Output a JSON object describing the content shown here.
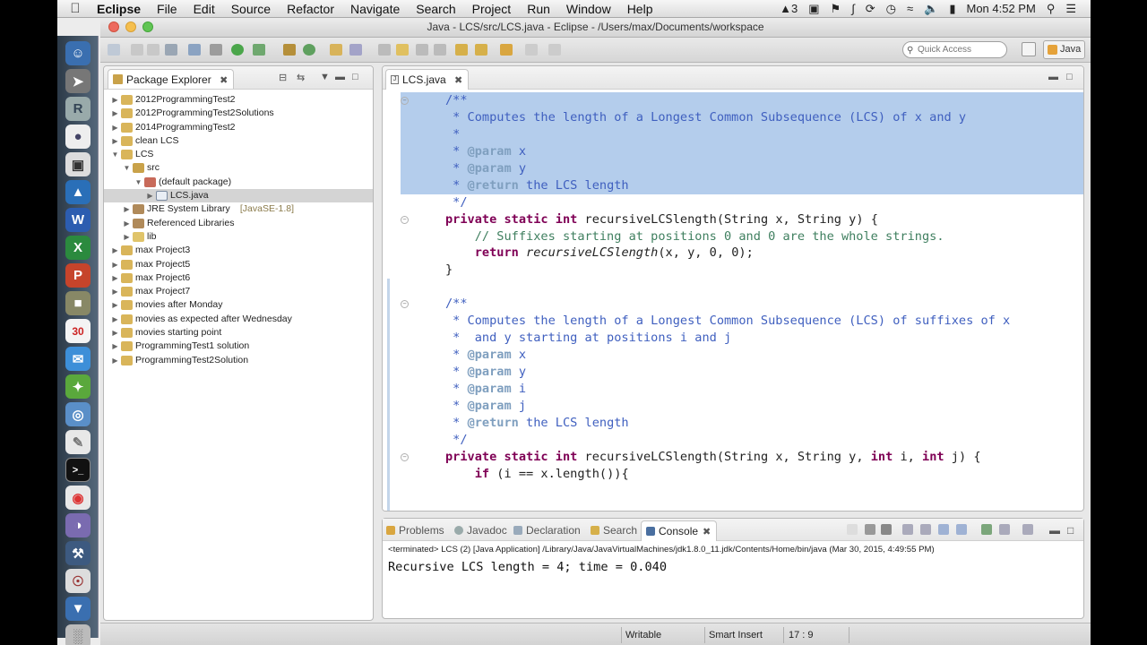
{
  "menubar": {
    "app_name": "Eclipse",
    "items": [
      "File",
      "Edit",
      "Source",
      "Refactor",
      "Navigate",
      "Search",
      "Project",
      "Run",
      "Window",
      "Help"
    ],
    "badge_count": "3",
    "clock": "Mon 4:52 PM"
  },
  "window": {
    "title": "Java - LCS/src/LCS.java - Eclipse - /Users/max/Documents/workspace"
  },
  "toolbar": {
    "quick_access_placeholder": "Quick Access",
    "perspective_label": "Java"
  },
  "package_explorer": {
    "title": "Package Explorer",
    "items": [
      {
        "label": "2012ProgrammingTest2",
        "level": 0,
        "expanded": false
      },
      {
        "label": "2012ProgrammingTest2Solutions",
        "level": 0,
        "expanded": false
      },
      {
        "label": "2014ProgrammingTest2",
        "level": 0,
        "expanded": false
      },
      {
        "label": "clean LCS",
        "level": 0,
        "expanded": false
      },
      {
        "label": "LCS",
        "level": 0,
        "expanded": true
      },
      {
        "label": "src",
        "level": 1,
        "expanded": true
      },
      {
        "label": "(default package)",
        "level": 2,
        "expanded": true
      },
      {
        "label": "LCS.java",
        "level": 3,
        "expanded": false,
        "selected": true
      },
      {
        "label": "JRE System Library",
        "suffix": "[JavaSE-1.8]",
        "level": 1,
        "expanded": false
      },
      {
        "label": "Referenced Libraries",
        "level": 1,
        "expanded": false
      },
      {
        "label": "lib",
        "level": 1,
        "expanded": false
      },
      {
        "label": "max Project3",
        "level": 0,
        "expanded": false
      },
      {
        "label": "max Project5",
        "level": 0,
        "expanded": false
      },
      {
        "label": "max Project6",
        "level": 0,
        "expanded": false
      },
      {
        "label": "max Project7",
        "level": 0,
        "expanded": false
      },
      {
        "label": "movies after Monday",
        "level": 0,
        "expanded": false
      },
      {
        "label": "movies as expected after Wednesday",
        "level": 0,
        "expanded": false
      },
      {
        "label": "movies starting point",
        "level": 0,
        "expanded": false
      },
      {
        "label": "ProgrammingTest1 solution",
        "level": 0,
        "expanded": false
      },
      {
        "label": "ProgrammingTest2Solution",
        "level": 0,
        "expanded": false
      }
    ]
  },
  "editor": {
    "tab_label": "LCS.java",
    "lines": [
      "/**",
      " * Computes the length of a Longest Common Subsequence (LCS) of x and y",
      " *",
      " * @param x",
      " * @param y",
      " * @return the LCS length",
      " */",
      "private static int recursiveLCSlength(String x, String y) {",
      "    // Suffixes starting at positions 0 and 0 are the whole strings.",
      "    return recursiveLCSlength(x, y, 0, 0);",
      "}",
      "",
      "/**",
      " * Computes the length of a Longest Common Subsequence (LCS) of suffixes of x",
      " *  and y starting at positions i and j",
      " * @param x",
      " * @param y",
      " * @param i",
      " * @param j",
      " * @return the LCS length",
      " */",
      "private static int recursiveLCSlength(String x, String y, int i, int j) {",
      "    if (i == x.length()){"
    ]
  },
  "bottom_panel": {
    "tabs": [
      "Problems",
      "Javadoc",
      "Declaration",
      "Search",
      "Console"
    ],
    "active_tab": "Console",
    "terminated_line": "<terminated> LCS (2) [Java Application] /Library/Java/JavaVirtualMachines/jdk1.8.0_11.jdk/Contents/Home/bin/java (Mar 30, 2015, 4:49:55 PM)",
    "output": "Recursive LCS length = 4; time = 0.040"
  },
  "statusbar": {
    "mode": "Writable",
    "insert_mode": "Smart Insert",
    "position": "17 : 9"
  },
  "colors": {
    "selection": "#b4cdec",
    "keyword": "#7f0055",
    "comment": "#3f5fbf",
    "line_comment": "#3f7f5f",
    "javadoc_tag": "#7f9fbf"
  }
}
